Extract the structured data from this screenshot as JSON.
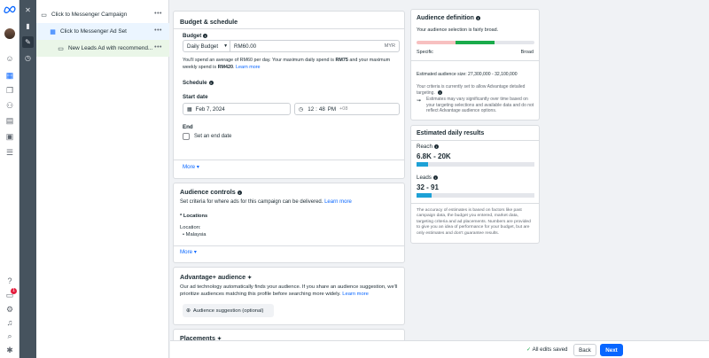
{
  "colors": {
    "accent": "#0866ff",
    "success": "#1aab4b"
  },
  "rail": {
    "icons": [
      "meta-logo",
      "avatar",
      "emoji-icon",
      "grid-icon",
      "pages-icon",
      "audience-icon",
      "business-icon",
      "billing-icon",
      "menu-icon",
      "help-icon",
      "notification-icon",
      "settings-icon",
      "alert-icon",
      "search-icon",
      "bug-icon"
    ],
    "notification_count": "1"
  },
  "tree": {
    "campaign": "Click to Messenger Campaign",
    "adset": "Click to Messenger Ad Set",
    "ad": "New Leads Ad with recommend...",
    "more": "•••"
  },
  "budget": {
    "title": "Budget & schedule",
    "budget_label": "Budget",
    "type": "Daily Budget",
    "amount": "RM60.00",
    "currency": "MYR",
    "note_a": "You'll spend an average of RM60 per day. Your maximum daily spend is ",
    "note_max_daily": "RM75",
    "note_b": " and your maximum weekly spend is ",
    "note_max_weekly": "RM420",
    "note_c": ". ",
    "learn_more": "Learn more",
    "schedule": "Schedule",
    "start_date": "Start date",
    "date": "Feb 7, 2024",
    "hour": "12",
    "minute": "48",
    "ampm": "PM",
    "tz": "+08",
    "end": "End",
    "set_end": "Set an end date",
    "more": "More"
  },
  "audience_controls": {
    "title": "Audience controls",
    "desc": "Set criteria for where ads for this campaign can be delivered.",
    "learn_more": "Learn more",
    "locations": "* Locations",
    "location_label": "Location:",
    "location_value": "• Malaysia",
    "more": "More"
  },
  "advantage": {
    "title": "Advantage+ audience",
    "desc": "Our ad technology automatically finds your audience. If you share an audience suggestion, we'll prioritize audiences matching this profile before searching more widely.",
    "learn_more": "Learn more",
    "button": "Audience suggestion (optional)"
  },
  "placements": {
    "title": "Placements"
  },
  "definition": {
    "title": "Audience definition",
    "status": "Your audience selection is fairly broad.",
    "specific": "Specific",
    "broad": "Broad",
    "size": "Estimated audience size: 27,300,000 - 32,100,000",
    "criteria": "Your criteria is currently set to allow Advantage detailed targeting.",
    "estimates": "Estimates may vary significantly over time based on your targeting selections and available data and do not reflect Advantage audience options."
  },
  "results": {
    "title": "Estimated daily results",
    "reach_label": "Reach",
    "reach_value": "6.8K - 20K",
    "reach_fill": 0.1,
    "leads_label": "Leads",
    "leads_value": "32 - 91",
    "leads_fill": 0.13,
    "disclaimer": "The accuracy of estimates is based on factors like past campaign data, the budget you entered, market data, targeting criteria and ad placements. Numbers are provided to give you an idea of performance for your budget, but are only estimates and don't guarantee results."
  },
  "footer": {
    "saved": "All edits saved",
    "back": "Back",
    "next": "Next"
  }
}
